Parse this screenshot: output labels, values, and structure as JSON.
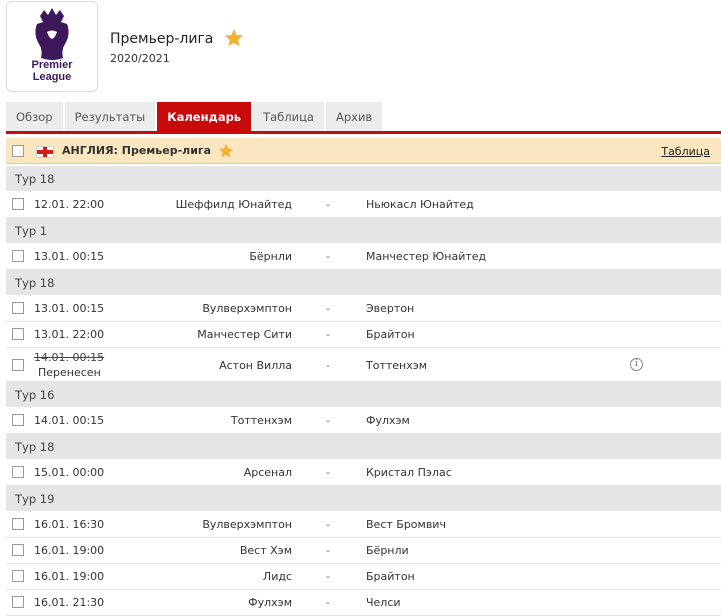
{
  "header": {
    "logo_text_line1": "Premier",
    "logo_text_line2": "League",
    "league_name": "Премьер-лига",
    "season": "2020/2021",
    "favorite_icon": "star-icon"
  },
  "tabs": [
    {
      "label": "Обзор",
      "active": false
    },
    {
      "label": "Результаты",
      "active": false
    },
    {
      "label": "Календарь",
      "active": true
    },
    {
      "label": "Таблица",
      "active": false
    },
    {
      "label": "Архив",
      "active": false
    }
  ],
  "league_bar": {
    "country_flag_icon": "england-flag-icon",
    "title": "АНГЛИЯ: Премьер-лига",
    "table_link": "Таблица"
  },
  "schedule": [
    {
      "round": "Тур 18"
    },
    {
      "time": "12.01. 22:00",
      "home": "Шеффилд Юнайтед",
      "dash": "-",
      "away": "Ньюкасл Юнайтед"
    },
    {
      "round": "Тур 1"
    },
    {
      "time": "13.01. 00:15",
      "home": "Бёрнли",
      "dash": "-",
      "away": "Манчестер Юнайтед"
    },
    {
      "round": "Тур 18"
    },
    {
      "time": "13.01. 00:15",
      "home": "Вулверхэмптон",
      "dash": "-",
      "away": "Эвертон"
    },
    {
      "time": "13.01. 22:00",
      "home": "Манчестер Сити",
      "dash": "-",
      "away": "Брайтон"
    },
    {
      "time": "14.01. 00:15",
      "status": "Перенесен",
      "home": "Астон Вилла",
      "dash": "-",
      "away": "Тоттенхэм",
      "info_icon": "i"
    },
    {
      "round": "Тур 16"
    },
    {
      "time": "14.01. 00:15",
      "home": "Тоттенхэм",
      "dash": "-",
      "away": "Фулхэм"
    },
    {
      "round": "Тур 18"
    },
    {
      "time": "15.01. 00:00",
      "home": "Арсенал",
      "dash": "-",
      "away": "Кристал Пэлас"
    },
    {
      "round": "Тур 19"
    },
    {
      "time": "16.01. 16:30",
      "home": "Вулверхэмптон",
      "dash": "-",
      "away": "Вест Бромвич"
    },
    {
      "time": "16.01. 19:00",
      "home": "Вест Хэм",
      "dash": "-",
      "away": "Бёрнли"
    },
    {
      "time": "16.01. 19:00",
      "home": "Лидс",
      "dash": "-",
      "away": "Брайтон"
    },
    {
      "time": "16.01. 21:30",
      "home": "Фулхэм",
      "dash": "-",
      "away": "Челси"
    }
  ]
}
